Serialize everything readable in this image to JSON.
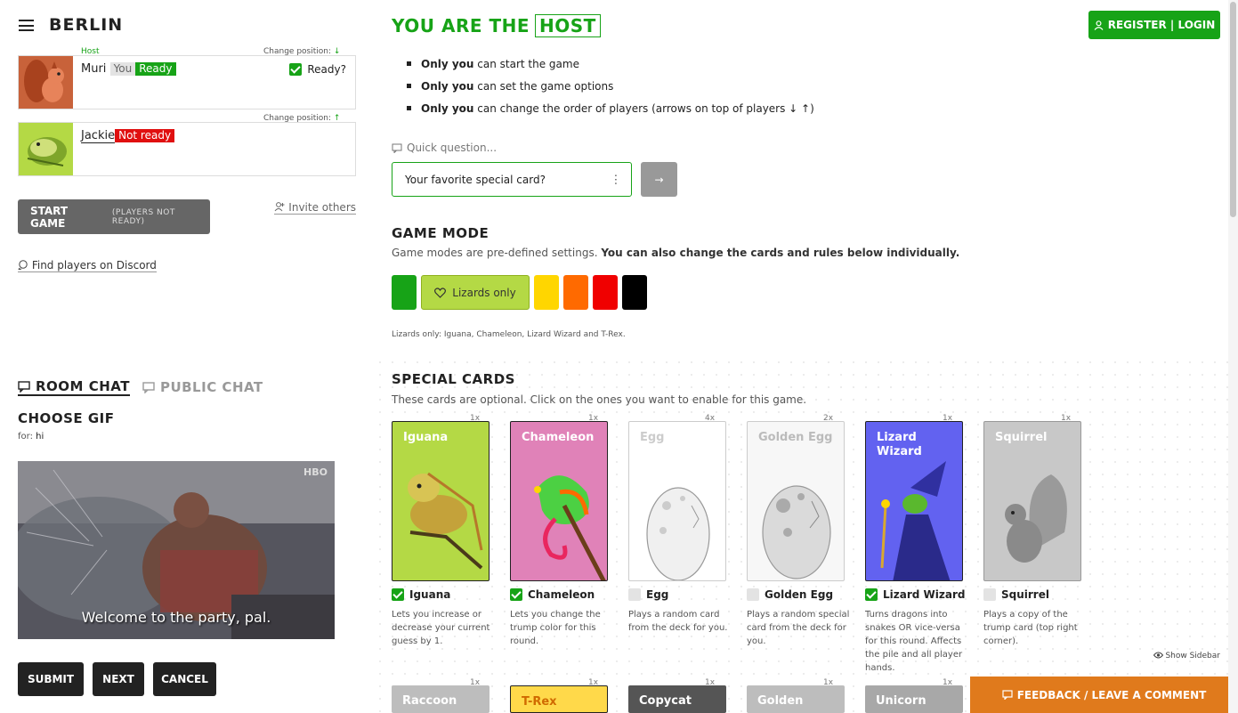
{
  "room": {
    "title": "BERLIN"
  },
  "players": [
    {
      "host_label": "Host",
      "change_position": "Change position:",
      "arrow": "↓",
      "name": "Muri",
      "you": "You",
      "status": "Ready",
      "ready_check": "Ready?"
    },
    {
      "change_position": "Change position:",
      "arrow": "↑",
      "name": "Jackie",
      "status": "Not ready"
    }
  ],
  "start": {
    "label": "START GAME",
    "note": "(PLAYERS NOT READY)"
  },
  "invite": "Invite others",
  "discord": "Find players on Discord",
  "chat": {
    "tab_room": "ROOM CHAT",
    "tab_public": "PUBLIC CHAT",
    "gif_title": "CHOOSE GIF",
    "for_label": "for:",
    "for_value": "hi",
    "gif_caption": "Welcome to the party, pal.",
    "gif_logo": "HBO",
    "submit": "SUBMIT",
    "next": "NEXT",
    "cancel": "CANCEL"
  },
  "host": {
    "title_pre": "YOU ARE THE",
    "title_box": "HOST",
    "rules": [
      {
        "bold": "Only you",
        "rest": " can start the game"
      },
      {
        "bold": "Only you",
        "rest": " can set the game options"
      },
      {
        "bold": "Only you",
        "rest": " can change the order of players (arrows on top of players ↓ ↑)"
      }
    ]
  },
  "register": "REGISTER | LOGIN",
  "quick_question": {
    "label": "Quick question...",
    "value": "Your favorite special card?",
    "send": "→"
  },
  "game_mode": {
    "title": "GAME MODE",
    "sub_plain": "Game modes are pre-defined settings. ",
    "sub_bold": "You can also change the cards and rules below individually.",
    "selected": "Lizards only",
    "description": "Lizards only: Iguana, Chameleon, Lizard Wizard and T-Rex.",
    "colors": {
      "green": "#17a317",
      "lime": "#b4d945",
      "yellow": "#ffd600",
      "orange": "#ff6a00",
      "red": "#f00000",
      "black": "#000000"
    }
  },
  "special_cards": {
    "title": "SPECIAL CARDS",
    "sub": "These cards are optional. Click on the ones you want to enable for this game.",
    "cards": [
      {
        "name": "Iguana",
        "count": "1x",
        "label": "Iguana",
        "desc": "Lets you increase or decrease your current guess by 1."
      },
      {
        "name": "Chameleon",
        "count": "1x",
        "label": "Chameleon",
        "desc": "Lets you change the trump color for this round."
      },
      {
        "name": "Egg",
        "count": "4x",
        "label": "Egg",
        "desc": "Plays a random card from the deck for you."
      },
      {
        "name": "Golden Egg",
        "count": "2x",
        "label": "Golden Egg",
        "desc": "Plays a random special card from the deck for you."
      },
      {
        "name": "Lizard Wizard",
        "count": "1x",
        "label": "Lizard Wizard",
        "desc": "Turns dragons into snakes OR vice-versa for this round. Affects the pile and all player hands."
      },
      {
        "name": "Squirrel",
        "count": "1x",
        "label": "Squirrel",
        "desc": "Plays a copy of the trump card (top right corner)."
      }
    ],
    "row2": [
      {
        "name": "Raccoon",
        "count": "1x"
      },
      {
        "name": "T-Rex",
        "count": "1x"
      },
      {
        "name": "Copycat",
        "count": "1x"
      },
      {
        "name": "Golden",
        "count": "1x"
      },
      {
        "name": "Unicorn",
        "count": "1x"
      }
    ]
  },
  "show_sidebar": "Show Sidebar",
  "feedback": "FEEDBACK / LEAVE A COMMENT"
}
